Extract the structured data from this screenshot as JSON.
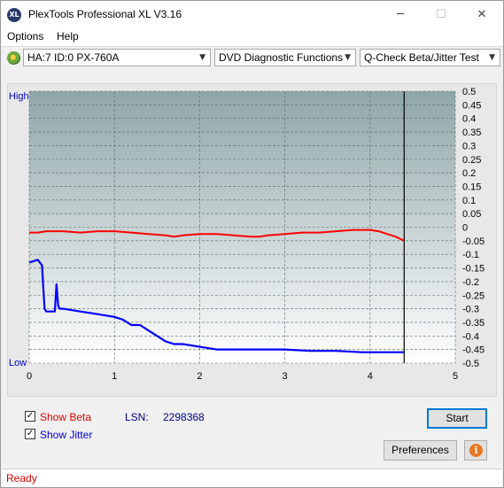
{
  "window": {
    "title": "PlexTools Professional XL V3.16",
    "app_icon_text": "XL",
    "minimize": "─",
    "maximize": "☐",
    "close": "✕"
  },
  "menu": {
    "options": "Options",
    "help": "Help"
  },
  "toolbar": {
    "drive": "HA:7 ID:0  PX-760A",
    "function": "DVD Diagnostic Functions",
    "test": "Q-Check Beta/Jitter Test"
  },
  "colors": {
    "beta": "#ff0000",
    "jitter": "#0000ff",
    "plot_top": "#8fa6a8",
    "plot_bottom": "#ffffff",
    "marker": "#000000"
  },
  "chart_data": {
    "type": "line",
    "y_left_labels": {
      "high": "High",
      "low": "Low"
    },
    "x_ticks": [
      "0",
      "1",
      "2",
      "3",
      "4",
      "5"
    ],
    "xlim": [
      0,
      5
    ],
    "y_right_ticks": [
      "0.5",
      "0.45",
      "0.4",
      "0.35",
      "0.3",
      "0.25",
      "0.2",
      "0.15",
      "0.1",
      "0.05",
      "0",
      "-0.05",
      "-0.1",
      "-0.15",
      "-0.2",
      "-0.25",
      "-0.3",
      "-0.35",
      "-0.4",
      "-0.45",
      "-0.5"
    ],
    "ylim": [
      -0.5,
      0.5
    ],
    "end_marker_x": 4.4,
    "grid": true,
    "series": [
      {
        "key": "beta",
        "values_x": [
          0,
          0.1,
          0.2,
          0.4,
          0.6,
          0.8,
          1.0,
          1.2,
          1.4,
          1.6,
          1.7,
          1.8,
          2.0,
          2.2,
          2.4,
          2.6,
          2.7,
          2.8,
          3.0,
          3.2,
          3.4,
          3.6,
          3.8,
          3.9,
          4.0,
          4.1,
          4.2,
          4.3,
          4.4
        ],
        "values_y": [
          -0.02,
          -0.02,
          -0.015,
          -0.015,
          -0.02,
          -0.015,
          -0.015,
          -0.02,
          -0.025,
          -0.03,
          -0.035,
          -0.03,
          -0.025,
          -0.025,
          -0.03,
          -0.035,
          -0.035,
          -0.03,
          -0.025,
          -0.02,
          -0.02,
          -0.015,
          -0.01,
          -0.01,
          -0.01,
          -0.015,
          -0.025,
          -0.035,
          -0.05
        ]
      },
      {
        "key": "jitter",
        "values_x": [
          0,
          0.1,
          0.15,
          0.18,
          0.2,
          0.3,
          0.32,
          0.34,
          0.36,
          0.4,
          0.6,
          0.8,
          1.0,
          1.1,
          1.2,
          1.3,
          1.4,
          1.5,
          1.6,
          1.7,
          1.8,
          2.0,
          2.2,
          2.5,
          2.8,
          3.0,
          3.3,
          3.6,
          3.9,
          4.1,
          4.3,
          4.4
        ],
        "values_y": [
          -0.13,
          -0.12,
          -0.14,
          -0.3,
          -0.31,
          -0.31,
          -0.21,
          -0.29,
          -0.3,
          -0.3,
          -0.31,
          -0.32,
          -0.33,
          -0.34,
          -0.36,
          -0.36,
          -0.38,
          -0.4,
          -0.42,
          -0.43,
          -0.43,
          -0.44,
          -0.45,
          -0.45,
          -0.45,
          -0.45,
          -0.455,
          -0.455,
          -0.46,
          -0.46,
          -0.46,
          -0.46
        ]
      }
    ]
  },
  "bottom": {
    "show_beta": "Show Beta",
    "show_beta_checked": "✓",
    "show_jitter": "Show Jitter",
    "show_jitter_checked": "✓",
    "lsn_label": "LSN:",
    "lsn_value": "2298368",
    "start": "Start",
    "preferences": "Preferences",
    "info": "i"
  },
  "status": {
    "text": "Ready"
  }
}
